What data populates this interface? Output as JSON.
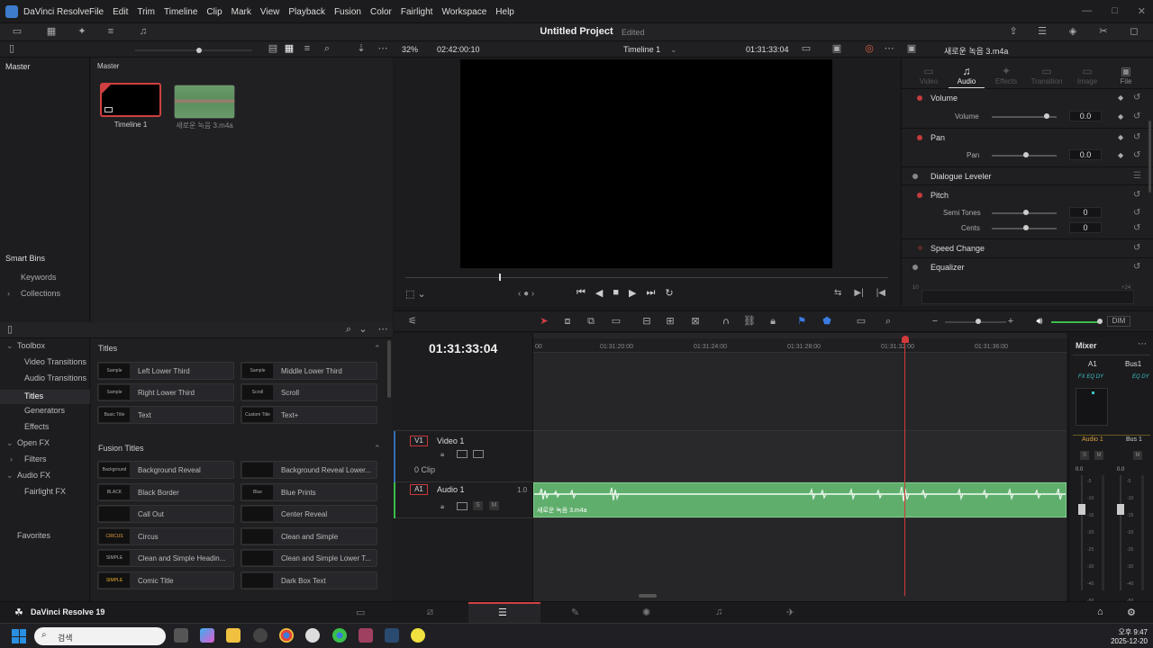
{
  "app": {
    "name": "DaVinci Resolve",
    "footer_name": "DaVinci Resolve 19"
  },
  "menu": [
    "File",
    "Edit",
    "Trim",
    "Timeline",
    "Clip",
    "Mark",
    "View",
    "Playback",
    "Fusion",
    "Color",
    "Fairlight",
    "Workspace",
    "Help"
  ],
  "project": {
    "title": "Untitled Project",
    "status": "Edited"
  },
  "viewer": {
    "zoom": "32%",
    "source_tc": "02:42:00:10",
    "timeline_name": "Timeline 1",
    "record_tc": "01:31:33:04",
    "clip_name": "새로운 녹음 3.m4a"
  },
  "media_pool": {
    "bin_header": "Master",
    "bins": [
      "Master"
    ],
    "smart_bins": {
      "title": "Smart Bins",
      "items": [
        "Keywords",
        "Collections"
      ]
    },
    "clips": [
      {
        "name": "Timeline 1"
      },
      {
        "name": "새로운 녹음 3.m4a"
      }
    ]
  },
  "toolbox": {
    "items": [
      "Toolbox",
      "Video Transitions",
      "Audio Transitions",
      "Titles",
      "Generators",
      "Effects",
      "Open FX",
      "Filters",
      "Audio FX",
      "Fairlight FX",
      "Favorites"
    ],
    "selected": "Titles"
  },
  "titles": {
    "section_label": "Titles",
    "items": [
      {
        "name": "Left Lower Third",
        "preview": "Sample"
      },
      {
        "name": "Middle Lower Third",
        "preview": "Sample"
      },
      {
        "name": "Right Lower Third",
        "preview": "Sample"
      },
      {
        "name": "Scroll",
        "preview": "Scroll"
      },
      {
        "name": "Text",
        "preview": "Basic Title"
      },
      {
        "name": "Text+",
        "preview": "Custom Title"
      }
    ]
  },
  "fusion_titles": {
    "section_label": "Fusion Titles",
    "items": [
      {
        "name": "Background Reveal",
        "preview": "Background Reveal"
      },
      {
        "name": "Background Reveal Lower...",
        "preview": ""
      },
      {
        "name": "Black Border",
        "preview": "BLACK"
      },
      {
        "name": "Blue Prints",
        "preview": "Blue"
      },
      {
        "name": "Call Out",
        "preview": ""
      },
      {
        "name": "Center Reveal",
        "preview": ""
      },
      {
        "name": "Circus",
        "preview": "CIRCUS"
      },
      {
        "name": "Clean and Simple",
        "preview": ""
      },
      {
        "name": "Clean and Simple Headin...",
        "preview": "SIMPLE"
      },
      {
        "name": "Clean and Simple Lower T...",
        "preview": ""
      },
      {
        "name": "Comic Title",
        "preview": "SIMPLE"
      },
      {
        "name": "Dark Box Text",
        "preview": ""
      }
    ]
  },
  "inspector": {
    "tabs": [
      "Video",
      "Audio",
      "Effects",
      "Transition",
      "Image",
      "File"
    ],
    "active_tab": "Audio",
    "sections": [
      {
        "title": "Volume",
        "params": [
          {
            "label": "Volume",
            "value": "0.0"
          }
        ]
      },
      {
        "title": "Pan",
        "params": [
          {
            "label": "Pan",
            "value": "0.0"
          }
        ]
      },
      {
        "title": "Dialogue Leveler",
        "params": []
      },
      {
        "title": "Pitch",
        "params": [
          {
            "label": "Semi Tones",
            "value": "0"
          },
          {
            "label": "Cents",
            "value": "0"
          }
        ]
      },
      {
        "title": "Speed Change",
        "params": []
      },
      {
        "title": "Equalizer",
        "params": []
      }
    ],
    "eq_scale": [
      "10",
      "+24"
    ]
  },
  "timeline": {
    "timecode": "01:31:33:04",
    "ruler": [
      "00",
      "01:31:20:00",
      "01:31:24:00",
      "01:31:28:00",
      "01:31:32:00",
      "01:31:36:00"
    ],
    "tracks": [
      {
        "id": "V1",
        "name": "Video 1",
        "info": "0 Clip"
      },
      {
        "id": "A1",
        "name": "Audio 1",
        "gain": "1.0",
        "clip": "새로운 녹음 3.m4a",
        "clip_color": "#5fae6c"
      }
    ],
    "dim_label": "DIM"
  },
  "mixer": {
    "title": "Mixer",
    "channels": [
      {
        "name": "A1",
        "fx": "FX EQ DY",
        "label": "Audio 1"
      },
      {
        "name": "Bus1",
        "fx": "EQ DY",
        "label": "Bus 1"
      }
    ],
    "value": "0.0",
    "scale": [
      "-5",
      "-10",
      "-15",
      "-20",
      "-25",
      "-30",
      "-40",
      "-50"
    ]
  },
  "taskbar": {
    "search_placeholder": "검색",
    "time": "오후 9:47",
    "date": "2025-12-20"
  },
  "colors": {
    "accent_red": "#c53b3b",
    "audio_clip": "#5fae6c",
    "playhead": "#d23a3a",
    "selected_thumb_border": "#d04040"
  }
}
